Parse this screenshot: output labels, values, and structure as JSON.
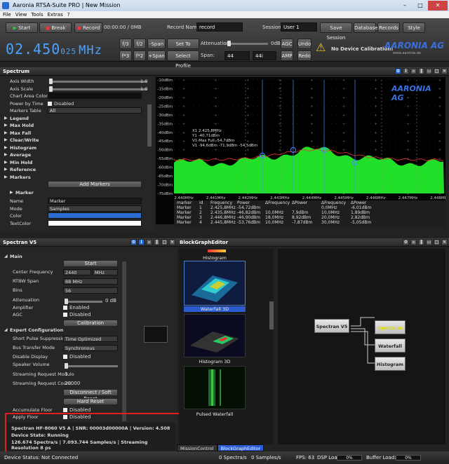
{
  "window": {
    "title": "Aaronia RTSA-Suite PRO | New Mission",
    "min": "–",
    "max": "□",
    "close": "✕"
  },
  "menu": [
    "File",
    "View",
    "Tools",
    "Extras",
    "?"
  ],
  "toolbar": {
    "start": "Start",
    "break": "Break",
    "record": "Record",
    "time": "00:00:00 / 0MB",
    "record_name_label": "Record Name:",
    "record_name": "record",
    "session_label": "Session:",
    "session": "User 1",
    "save_session": "Save Session",
    "database": "Database",
    "records": "Records",
    "style": "Style",
    "f3": "f/3",
    "f2": "f/2",
    "span_minus": "-Span",
    "set_cursor": "Set To Cursor",
    "attenuation_label": "Attenuation:",
    "att_value": "0dB",
    "agc": "AGC",
    "undo": "Undo",
    "f3x": "f*3",
    "f2x": "f*2",
    "span_plus": "+Span",
    "select_profile": "Select Profile",
    "span_label": "Span:",
    "span_val1": "44",
    "span_val2": "44i",
    "amp": "AMP",
    "redo": "Redo",
    "calibration_warning": "No Device Calibration!",
    "logo": "AARONIA AG",
    "logo_url": "www.aaronia.de"
  },
  "frequency": {
    "main": "02.450",
    "fine": "025",
    "unit": "MHz"
  },
  "spectrum": {
    "title": "Spectrum",
    "props": [
      {
        "k": "Axis Width",
        "v": "1.0",
        "type": "slider"
      },
      {
        "k": "Axis Scale",
        "v": "1.0",
        "type": "slider"
      },
      {
        "k": "Chart Area Color",
        "v": "",
        "type": "color"
      },
      {
        "k": "Power by Time",
        "v": "Disabled",
        "type": "check"
      },
      {
        "k": "Markers Table",
        "v": "All",
        "type": "select"
      },
      {
        "k": "Legend",
        "type": "section"
      },
      {
        "k": "Max Hold",
        "type": "section"
      },
      {
        "k": "Max Fall",
        "type": "section"
      },
      {
        "k": "Clear/Write",
        "type": "section"
      },
      {
        "k": "Histogram",
        "type": "section"
      },
      {
        "k": "Average",
        "type": "section"
      },
      {
        "k": "Min Hold",
        "type": "section"
      },
      {
        "k": "Reference",
        "type": "section"
      },
      {
        "k": "Markers",
        "type": "section"
      },
      {
        "k": "",
        "v": "Add Markers",
        "type": "button"
      },
      {
        "k": "Marker",
        "type": "section2"
      },
      {
        "k": "Name",
        "v": "Marker",
        "type": "text"
      },
      {
        "k": "Mode",
        "v": "Samples",
        "type": "select"
      },
      {
        "k": "Color",
        "v": "",
        "type": "bluecolor"
      },
      {
        "k": "TextColor",
        "v": "",
        "type": "whitecolor"
      }
    ],
    "y_ticks": [
      "-10dBm",
      "-15dBm",
      "-20dBm",
      "-25dBm",
      "-30dBm",
      "-35dBm",
      "-40dBm",
      "-45dBm",
      "-50dBm",
      "-55dBm",
      "-60dBm",
      "-65dBm",
      "-70dBm",
      "-75dBm"
    ],
    "x_ticks": [
      "2.440MHz",
      "2.441MHz",
      "2.442MHz",
      "2.443MHz",
      "2.444MHz",
      "2.445MHz",
      "2.446MHz",
      "2.447MHz",
      "2.448MHz"
    ],
    "annotation": [
      "X1             2.425,8MHz",
      "Y1             -40,71dBm",
      "V1-Max Full  -54,7dBm",
      "V1             -94,6dBm -71,9dBm -54,5dBm"
    ],
    "table_header": [
      "marker",
      "id",
      "Frequency",
      "Power",
      "ΔFrequency",
      "ΔPower",
      "ΔFrequency",
      "ΔPower"
    ],
    "table_rows": [
      [
        "Marker",
        "1",
        "2.425,8MHz",
        "-54,72dBm",
        "",
        "",
        "0,0MHz",
        "-6,01dBm"
      ],
      [
        "Marker",
        "2",
        "2.435,8MHz",
        "-46,82dBm",
        "10,0MHz",
        "7,9dBm",
        "10,0MHz",
        "1,89dBm"
      ],
      [
        "Marker",
        "3",
        "2.446,8MHz",
        "-46,90dBm",
        "18,0MHz",
        "8,92dBm",
        "20,0MHz",
        "2,82dBm"
      ],
      [
        "Marker",
        "4",
        "2.445,8MHz",
        "-53,76dBm",
        "10,0MHz",
        "-7,87dBm",
        "30,0MHz",
        "-5,05dBm"
      ]
    ]
  },
  "spectranv5": {
    "title": "Spectran V5",
    "main": "Main",
    "start": "Start",
    "center_label": "Center Frequency",
    "center": "2440",
    "center_unit": "MHz",
    "rtbw_label": "RTBW Span",
    "rtbw": "88 MHz",
    "bins_label": "Bins",
    "bins": "56",
    "att_label": "Attenuation",
    "att": "0 dB",
    "amp_label": "Amplifier",
    "amp": "Enabled",
    "agc_label": "AGC",
    "agc": "Disabled",
    "calibration": "Calibration",
    "expert": "Expert Configuration",
    "spsup_label": "Short Pulse Suppression",
    "spsup": "Time Optimized",
    "btm_label": "Bus Transfer Mode",
    "btm": "Synchronous",
    "disp_label": "Disable Display",
    "disp": "Disabled",
    "spk_label": "Speaker Volume",
    "srm_label": "Streaming Request Modulo",
    "srm": "1",
    "src_label": "Streaming Request Count",
    "src": "20000",
    "disconnect": "Disconnect / Soft Reset",
    "hardreset": "Hard Reset",
    "acc_label": "Accumulate Floor",
    "acc": "Disabled",
    "apply_label": "Apply Floor",
    "apply": "Disabled",
    "info1": "Spectran HF-8060 V5  A  |  SNR: 00003d00000A  |  Version: 4.508",
    "info2": "Device State: Running",
    "info3": "126.674 Spectra/s  |  7.093.744 Samples/s  |  Streaming Resolution 8 ps"
  },
  "blockgraph": {
    "title": "BlockGraphEditor",
    "thumbs": [
      "Histogram",
      "Waterfall 3D",
      "Histogram 3D",
      "Pulsed Waterfall"
    ],
    "nodes": {
      "src": "Spectran V5",
      "n1": "Spectrum",
      "n2": "Waterfall",
      "n3": "Histogram"
    }
  },
  "tabs": [
    "MissionControl",
    "BlockGraphEditor"
  ],
  "status": {
    "left": "Device Status: Not Connected",
    "spectra": "0 Spectra/s",
    "samples": "0 Samples/s",
    "fps": "FPS: 63",
    "dsp": "DSP Load:",
    "dsp_val": "0%",
    "buffer": "Buffer Load:",
    "buffer_val": "0%"
  },
  "colors": {
    "accent": "#2a6bd0",
    "freq": "#4aa3ff",
    "spectrum": "#22e02a",
    "highlight": "#e02020"
  }
}
